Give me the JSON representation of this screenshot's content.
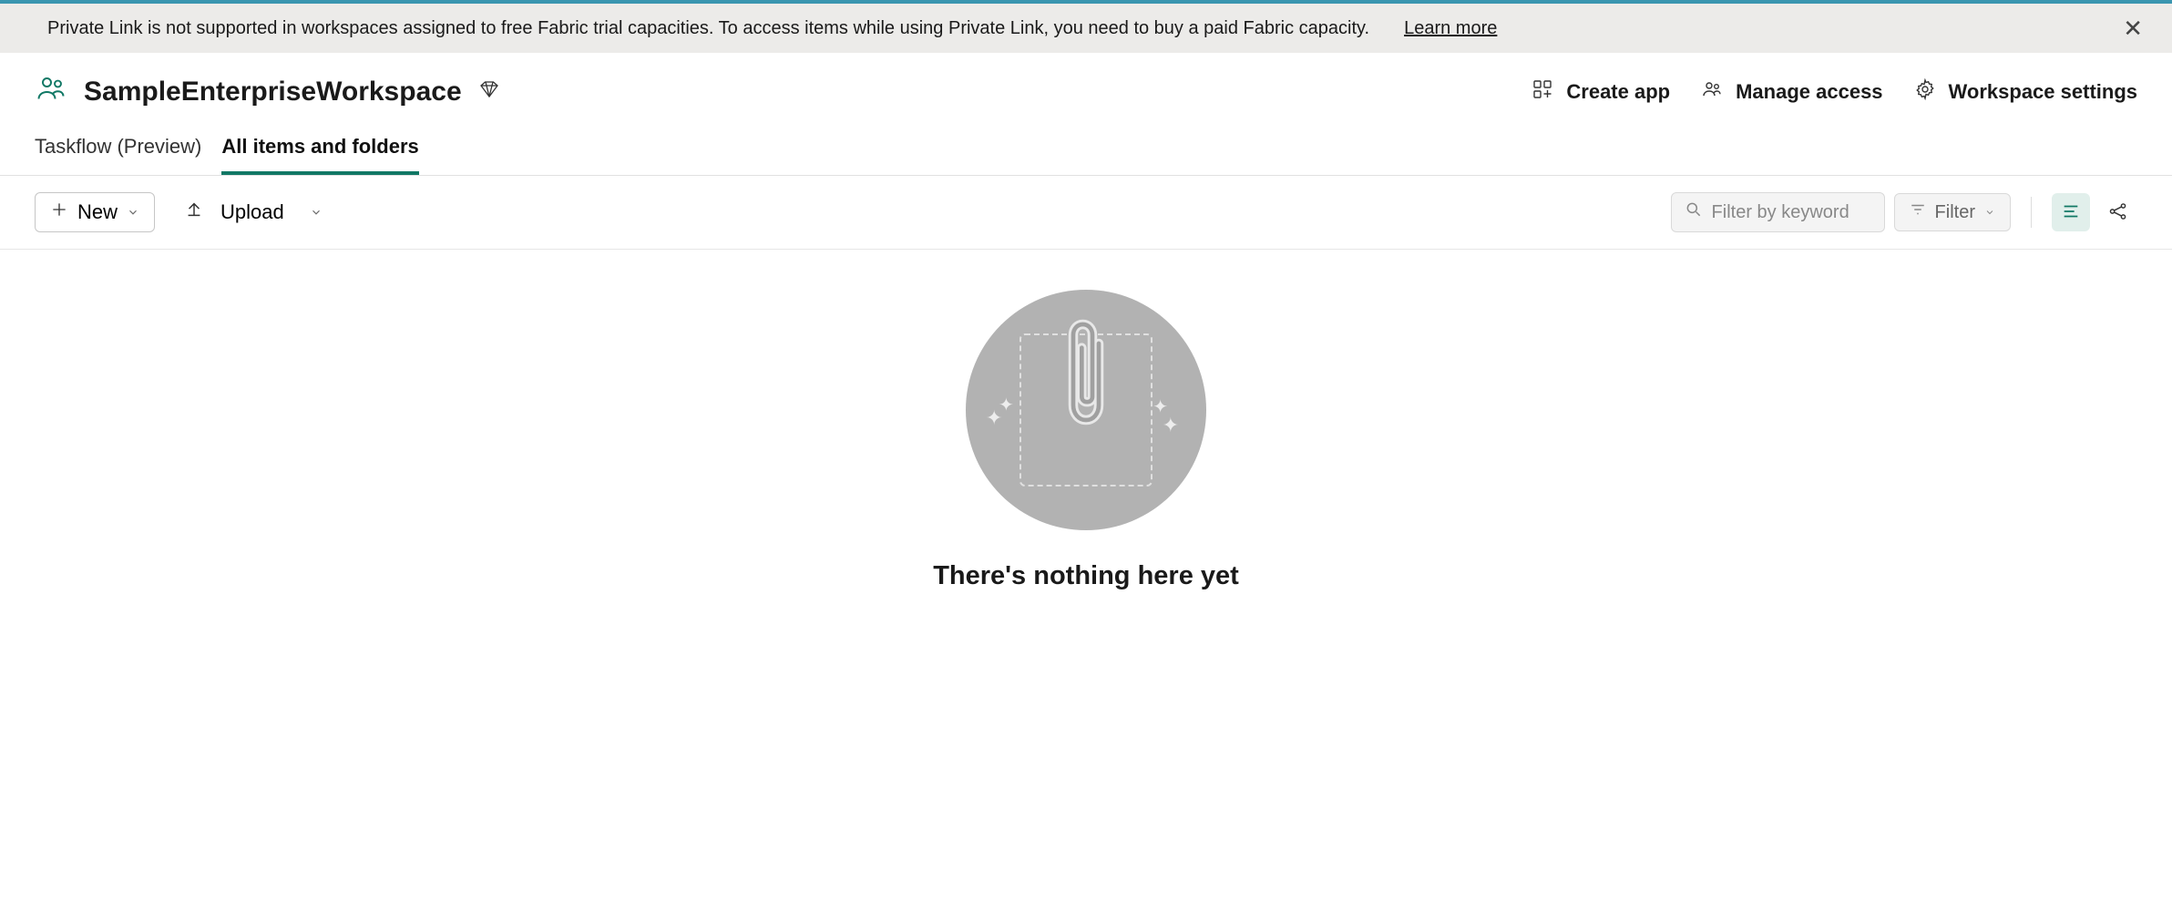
{
  "notification": {
    "message": "Private Link is not supported in workspaces assigned to free Fabric trial capacities. To access items while using Private Link, you need to buy a paid Fabric capacity.",
    "learn_more": "Learn more"
  },
  "workspace": {
    "title": "SampleEnterpriseWorkspace"
  },
  "header_actions": {
    "create_app": "Create app",
    "manage_access": "Manage access",
    "workspace_settings": "Workspace settings"
  },
  "tabs": {
    "taskflow": "Taskflow (Preview)",
    "all_items": "All items and folders"
  },
  "toolbar": {
    "new": "New",
    "upload": "Upload",
    "filter_placeholder": "Filter by keyword",
    "filter": "Filter"
  },
  "empty": {
    "title": "There's nothing here yet"
  }
}
